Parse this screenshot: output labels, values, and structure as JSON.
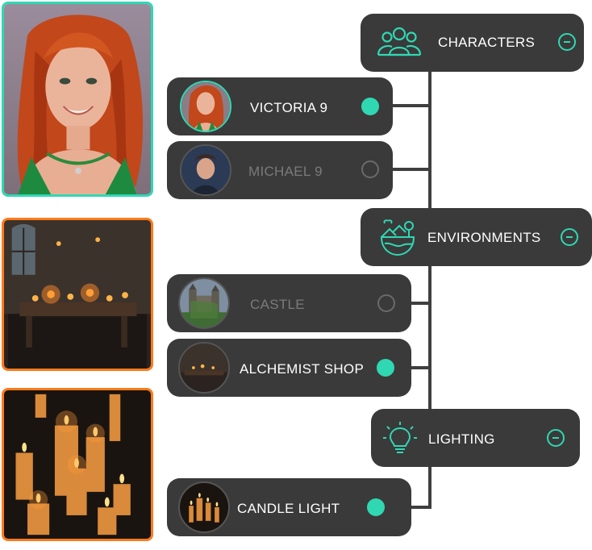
{
  "categories": {
    "characters": {
      "label": "CHARACTERS",
      "icon": "people-icon"
    },
    "environments": {
      "label": "ENVIRONMENTS",
      "icon": "landscape-icon"
    },
    "lighting": {
      "label": "LIGHTING",
      "icon": "lightbulb-icon"
    }
  },
  "items": {
    "victoria": {
      "label": "VICTORIA 9",
      "selected": true
    },
    "michael": {
      "label": "MICHAEL 9",
      "selected": false
    },
    "castle": {
      "label": "CASTLE",
      "selected": false
    },
    "alchemist": {
      "label": "ALCHEMIST SHOP",
      "selected": true
    },
    "candle": {
      "label": "CANDLE LIGHT",
      "selected": true
    }
  },
  "colors": {
    "accent": "#2fd8b3",
    "photo_border_orange": "#ff7a1a",
    "card_bg": "#3a3a3a"
  }
}
